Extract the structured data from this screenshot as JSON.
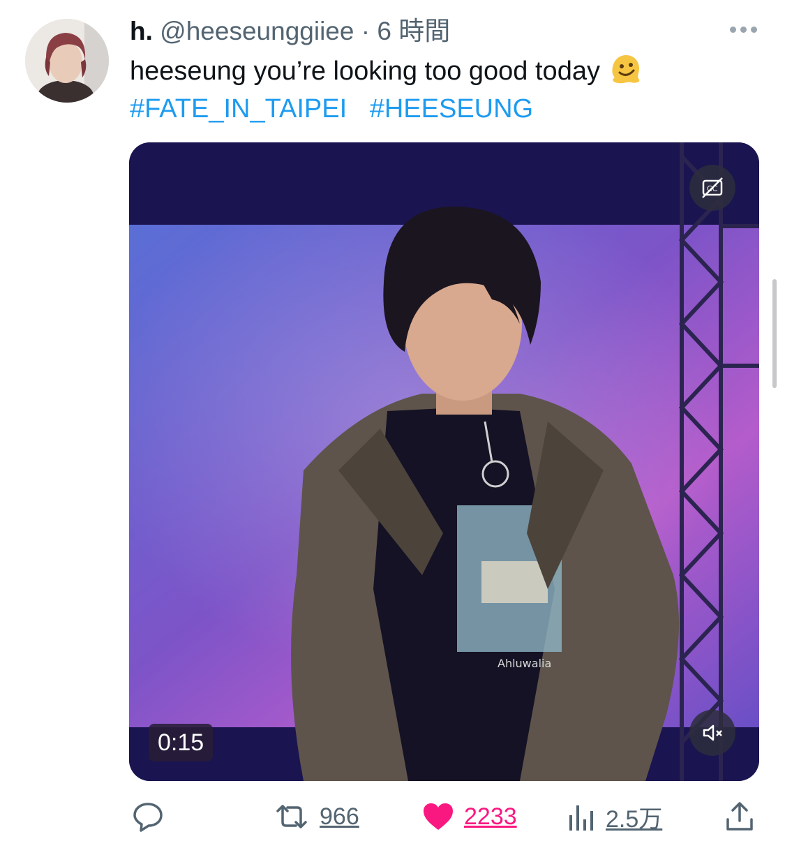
{
  "tweet": {
    "display_name": "h.",
    "handle": "@heeseunggiiee",
    "separator": "·",
    "time": "6 時間",
    "text": "heeseung you’re looking too good today",
    "hashtags": [
      "#FATE_IN_TAIPEI",
      "#HEESEUNG"
    ]
  },
  "media": {
    "duration": "0:15",
    "shirt_print": "Ahluwalia"
  },
  "actions": {
    "retweets": "966",
    "likes": "2233",
    "views": "2.5万"
  },
  "colors": {
    "link": "#1d9bf0",
    "like": "#f91880",
    "secondary_text": "#536471"
  }
}
